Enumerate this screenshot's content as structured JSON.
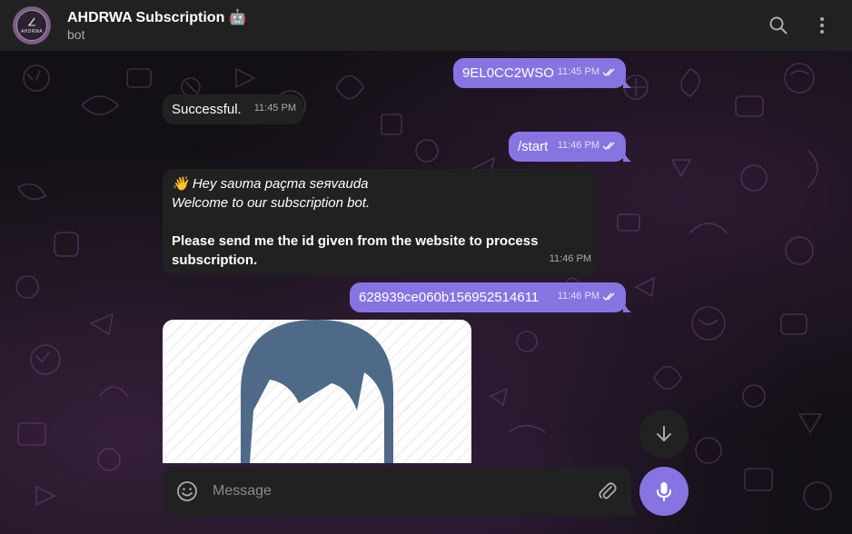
{
  "header": {
    "title": "AHDRWA Subscription 🤖",
    "subtitle": "bot",
    "avatar_text": "AHDRWA"
  },
  "icons": {
    "search": "search-icon",
    "more": "more-vertical-icon",
    "emoji": "smile-icon",
    "attach": "paperclip-icon",
    "mic": "microphone-icon",
    "scroll_down": "arrow-down-icon",
    "read_status": "double-check-icon"
  },
  "messages": [
    {
      "direction": "out",
      "text": "9EL0CC2WSO",
      "time": "11:45 PM"
    },
    {
      "direction": "in",
      "text": "Successful.",
      "time": "11:45 PM"
    },
    {
      "direction": "out",
      "text": "/start",
      "time": "11:46 PM"
    },
    {
      "direction": "in",
      "greeting": "👋 Hey ѕaυта paçтa ѕeяvaиda",
      "welcome": "Welcome to our subscription bot.",
      "body": "Please send me the id given from the website to process subscription.",
      "time": "11:46 PM"
    },
    {
      "direction": "out",
      "text": "628939ce060b156952514611",
      "time": "11:46 PM"
    }
  ],
  "composer": {
    "placeholder": "Message"
  },
  "colors": {
    "accent": "#8774e1",
    "header_bg": "#212121",
    "incoming_bg": "#212121",
    "outgoing_bg": "#8774e1",
    "avatar_hair": "#4f6a88"
  }
}
